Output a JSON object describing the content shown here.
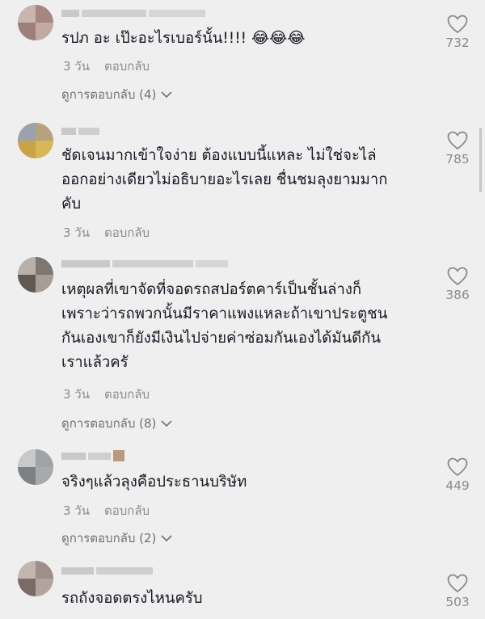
{
  "comments": [
    {
      "text": "รปภ อะ เป๊ะอะไรเบอร์นั้น!!!! ",
      "emoji": "😂😂😂",
      "time": "3 วัน",
      "reply_label": "ตอบกลับ",
      "view_replies": "ดูการตอบกลับ (4)",
      "likes": "732"
    },
    {
      "text": "ชัดเจนมากเข้าใจง่าย ต้องแบบนี้แหละ ไม่ใช่จะไล่\nออกอย่างเดียวไม่อธิบายอะไรเลย ชื่นชมลุงยามมาก\nคับ",
      "time": "3 วัน",
      "reply_label": "ตอบกลับ",
      "likes": "785"
    },
    {
      "text": "เหตุผลที่เขาจัดที่จอดรถสปอร์ตคาร์เป็นชั้นล่างก็\nเพราะว่ารถพวกนั้นมีราคาแพงแหละถ้าเขาประตูชน\nกันเองเขาก็ยังมีเงินไปจ่ายค่าซ่อมกันเองได้มันดีกัน\nเราแล้วครั",
      "time": "3 วัน",
      "reply_label": "ตอบกลับ",
      "view_replies": "ดูการตอบกลับ (8)",
      "likes": "386"
    },
    {
      "text": "จริงๆแล้วลุงคือประธานบริษัท",
      "time": "3 วัน",
      "reply_label": "ตอบกลับ",
      "view_replies": "ดูการตอบกลับ (2)",
      "likes": "449"
    },
    {
      "text": "รถถังจอดตรงไหนครับ",
      "likes": "503"
    }
  ],
  "icons": {
    "like": "heart-outline-icon",
    "expand": "chevron-down-icon"
  },
  "colors": {
    "background": "#efefef",
    "text": "#161823",
    "secondary": "#8a8b91"
  }
}
